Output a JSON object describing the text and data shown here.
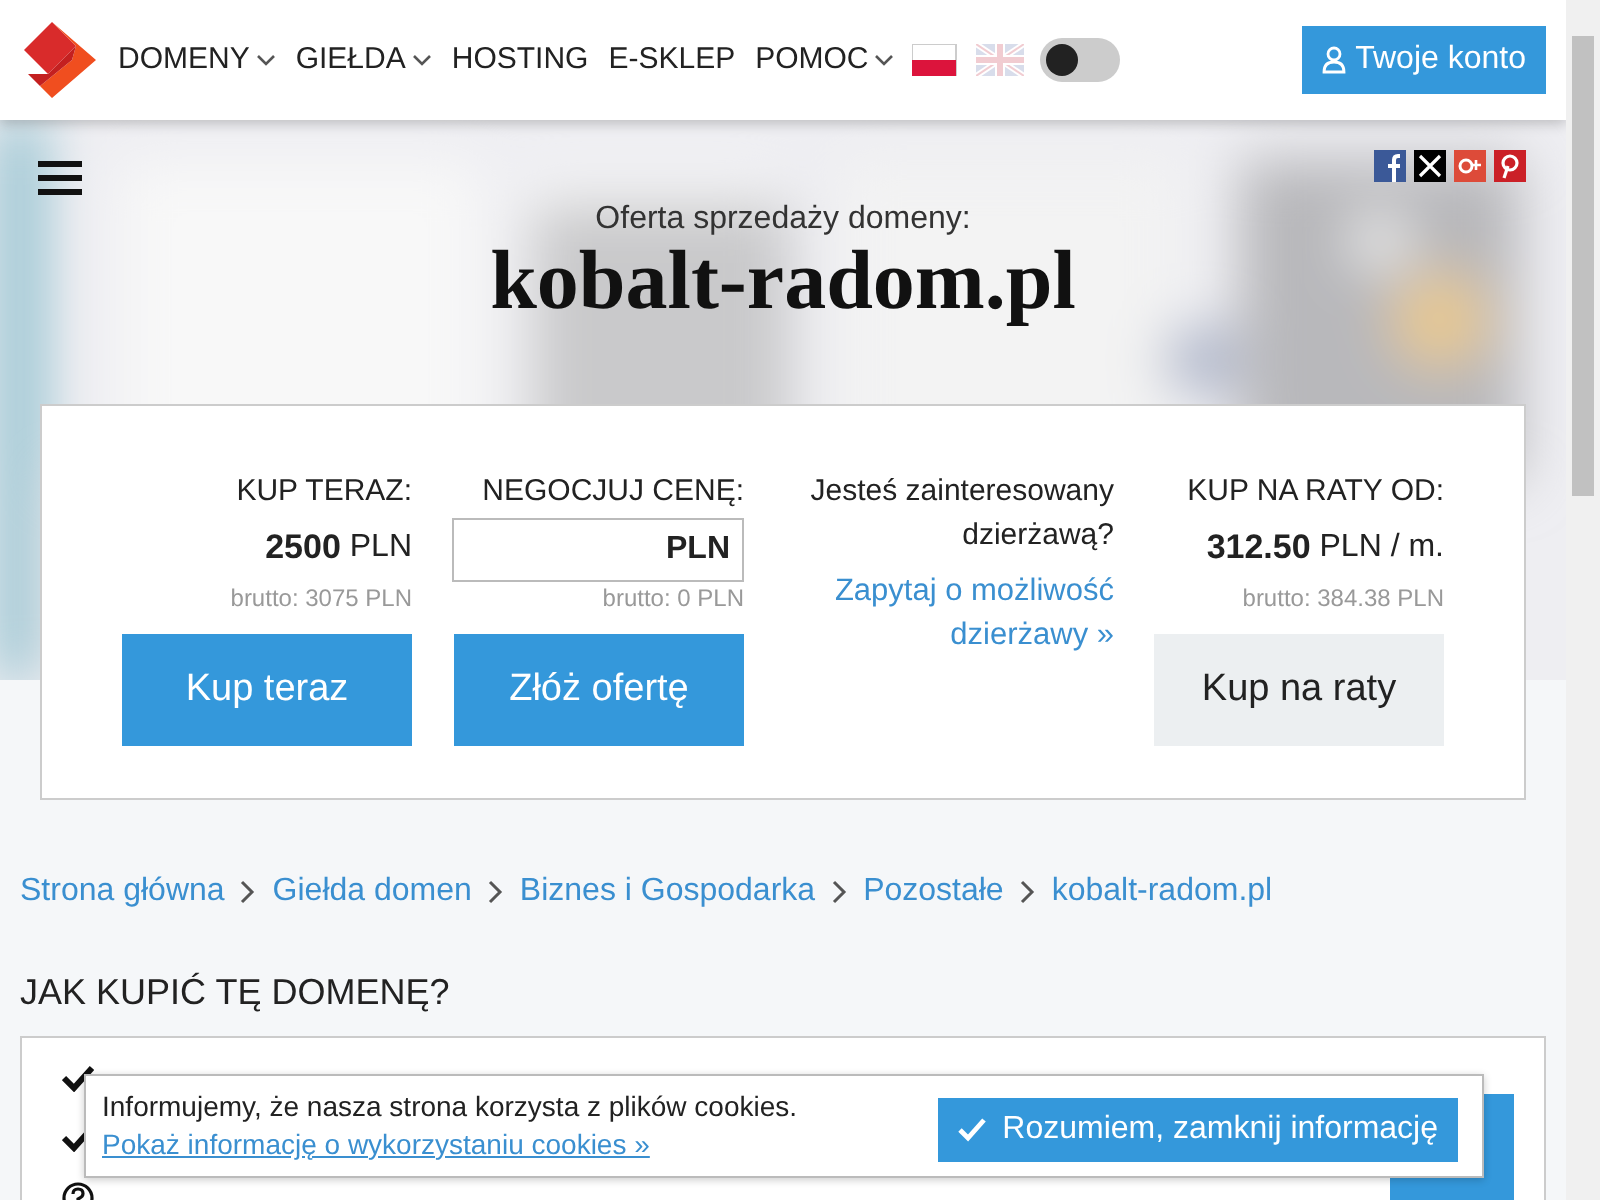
{
  "header": {
    "menu": [
      {
        "label": "DOMENY",
        "dropdown": true
      },
      {
        "label": "GIEŁDA",
        "dropdown": true
      },
      {
        "label": "HOSTING",
        "dropdown": false
      },
      {
        "label": "E-SKLEP",
        "dropdown": false
      },
      {
        "label": "POMOC",
        "dropdown": true
      }
    ],
    "languages": [
      {
        "kind": "pl",
        "selected": true
      },
      {
        "kind": "en",
        "selected": false
      }
    ],
    "theme_toggle": {
      "on": false
    },
    "account_button": "Twoje konto"
  },
  "hero": {
    "share": [
      {
        "kind": "facebook"
      },
      {
        "kind": "x"
      },
      {
        "kind": "googleplus"
      },
      {
        "kind": "pinterest"
      }
    ],
    "subtitle": "Oferta sprzedaży domeny:",
    "domain": "kobalt-radom.pl"
  },
  "offer": {
    "buy_now": {
      "label": "KUP TERAZ:",
      "price": "2500",
      "currency": "PLN",
      "gross": "brutto: 3075 PLN",
      "button": "Kup teraz"
    },
    "negotiate": {
      "label": "NEGOCJUJ CENĘ:",
      "currency": "PLN",
      "gross": "brutto: 0 PLN",
      "button": "Złóż ofertę"
    },
    "lease": {
      "question": "Jesteś zainteresowany dzierżawą?",
      "link": "Zapytaj o możliwość dzierżawy »"
    },
    "installments": {
      "label": "KUP NA RATY OD:",
      "price": "312.50",
      "currency": "PLN",
      "suffix": "/ m.",
      "gross": "brutto: 384.38 PLN",
      "button": "Kup na raty"
    }
  },
  "breadcrumbs": [
    "Strona główna",
    "Giełda domen",
    "Biznes i Gospodarka",
    "Pozostałe",
    "kobalt-radom.pl"
  ],
  "how_to_buy": {
    "heading": "JAK KUPIĆ TĘ DOMENĘ?",
    "items": [
      {
        "kind": "check"
      },
      {
        "kind": "check"
      },
      {
        "kind": "help"
      }
    ]
  },
  "cookie_notice": {
    "message": "Informujemy, że nasza strona korzysta z plików cookies.",
    "link": "Pokaż informację o wykorzystaniu cookies »",
    "button": "Rozumiem, zamknij informację"
  }
}
